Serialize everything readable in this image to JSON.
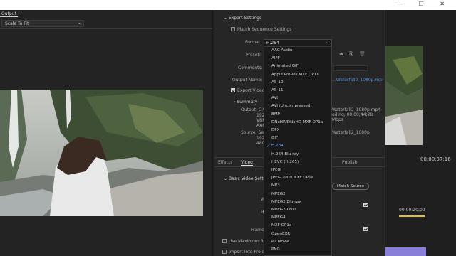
{
  "window": {
    "controls": "—  ☐  ✕"
  },
  "source": {
    "output_tab": "Output",
    "scale_select": "Scale To Fit"
  },
  "export_settings": {
    "header": "Export Settings",
    "match_sequence": "Match Sequence Settings",
    "match_sequence_checked": false,
    "format_label": "Format:",
    "format_value": "H.264",
    "preset_label": "Preset:",
    "comments_label": "Comments:",
    "output_name_label": "Output Name:",
    "output_name_value": "...Waterfall2_1080p.mp4",
    "export_video": "Export Video",
    "export_video_checked": true,
    "summary_header": "Summary",
    "output_label": "Output: C:\\",
    "output_lines": [
      "192",
      "VBR",
      "AAC"
    ],
    "output_right": [
      "Waterfall2_1080p.mp4",
      "oding, 00;00;44;28",
      "Mbps"
    ],
    "source_label": "Source: Seq",
    "source_lines": [
      "192",
      "480"
    ],
    "source_right": "Waterfall2_1080p"
  },
  "format_options": [
    "AAC Audio",
    "AIFF",
    "Animated GIF",
    "Apple ProRes MXF OP1a",
    "AS-10",
    "AS-11",
    "AVI",
    "AVI (Uncompressed)",
    "BMP",
    "DNxHR/DNxHD MXF OP1a",
    "DPX",
    "GIF",
    "H.264",
    "H.264 Blu-ray",
    "HEVC (H.265)",
    "JPEG",
    "JPEG 2000 MXF OP1a",
    "MP3",
    "MPEG2",
    "MPEG2 Blu-ray",
    "MPEG2-DVD",
    "MPEG4",
    "MXF OP1a",
    "OpenEXR",
    "P2 Movie",
    "PNG"
  ],
  "selected_format": "H.264",
  "lower_tabs": {
    "effects": "Effects",
    "video": "Video",
    "publish": "Publish"
  },
  "basic_video": {
    "header": "Basic Video Settings",
    "match_source": "Match Source",
    "frame_label": "Frame"
  },
  "bottom": {
    "use_max_render": "Use Maximum Ren",
    "import_into_project": "Import Into Project"
  },
  "program": {
    "timecode": "00;00:37;16",
    "ruler_time": "00;00:20;00"
  },
  "colors": {
    "accent_blue": "#4f8fe0",
    "timeline_purple": "#8a7fd8",
    "playhead_yellow": "#e0c030"
  }
}
